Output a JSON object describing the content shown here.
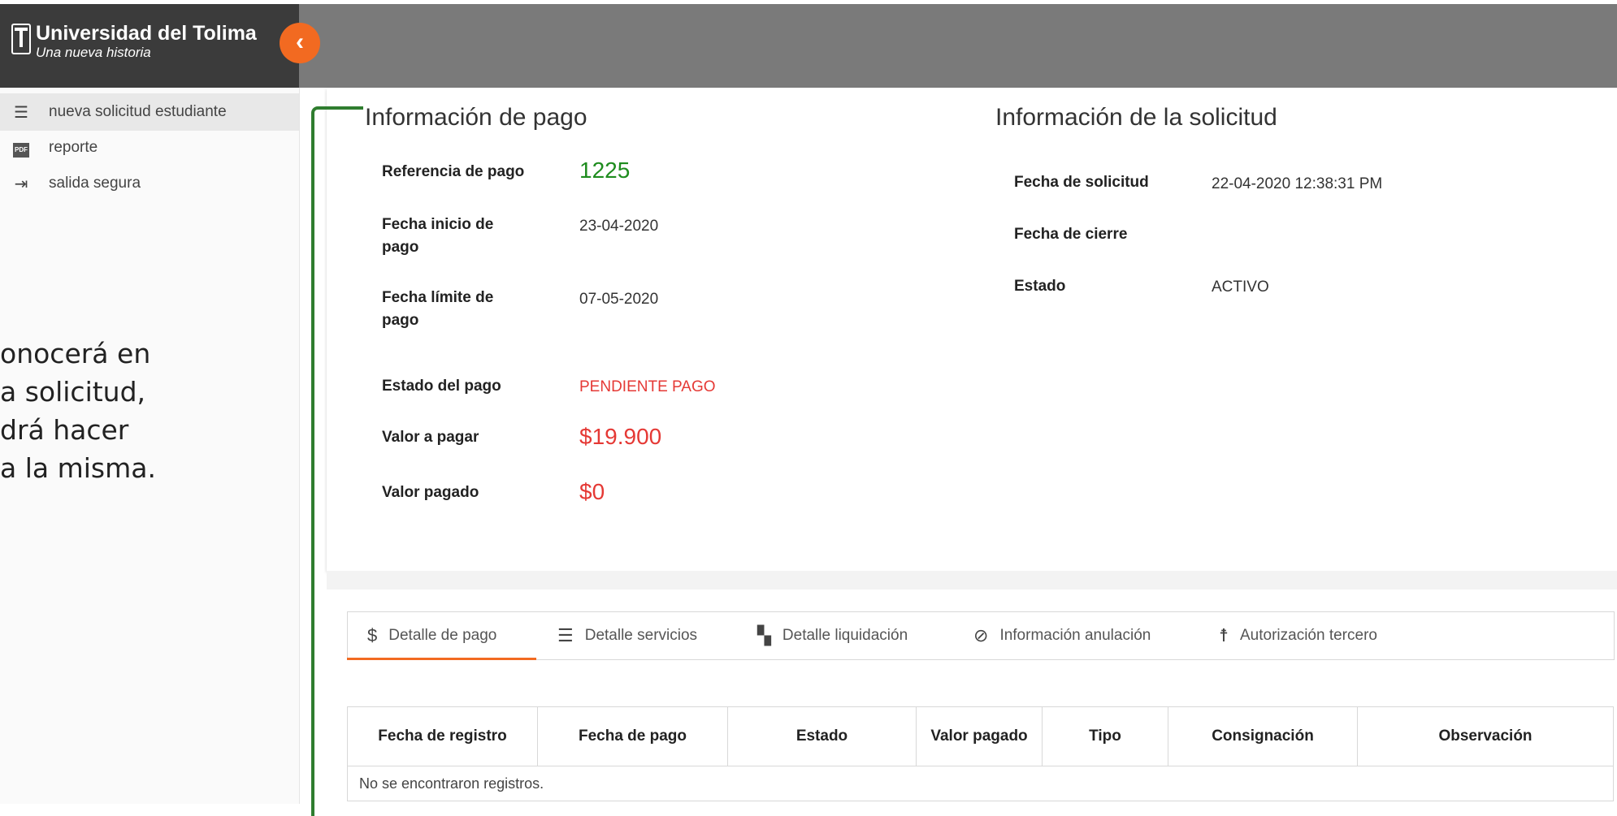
{
  "brand": {
    "name": "Universidad del Tolima",
    "slogan": "Una nueva historia"
  },
  "sidebar": {
    "items": [
      {
        "label": "nueva solicitud estudiante",
        "icon": "list-icon",
        "active": true
      },
      {
        "label": "reporte",
        "icon": "pdf-icon"
      },
      {
        "label": "salida segura",
        "icon": "logout-icon"
      }
    ],
    "pdf_badge": "PDF"
  },
  "overlay_text": [
    "onocerá en",
    "a solicitud,",
    "drá hacer",
    "a la misma."
  ],
  "payment": {
    "title": "Información de pago",
    "reference_label": "Referencia de pago",
    "reference_value": "1225",
    "start_label": "Fecha inicio de pago",
    "start_value": "23-04-2020",
    "limit_label": "Fecha límite de pago",
    "limit_value": "07-05-2020",
    "status_label": "Estado del pago",
    "status_value": "PENDIENTE PAGO",
    "amount_label": "Valor a pagar",
    "amount_value": "$19.900",
    "paid_label": "Valor pagado",
    "paid_value": "$0"
  },
  "request": {
    "title": "Información de la solicitud",
    "date_label": "Fecha de solicitud",
    "date_value": "22-04-2020 12:38:31 PM",
    "close_label": "Fecha de cierre",
    "close_value": "",
    "state_label": "Estado",
    "state_value": "ACTIVO"
  },
  "tabs": [
    {
      "label": "Detalle de pago",
      "icon": "dollar-icon",
      "glyph": "$",
      "active": true
    },
    {
      "label": "Detalle servicios",
      "icon": "services-icon",
      "glyph": "☰"
    },
    {
      "label": "Detalle liquidación",
      "icon": "liquidation-icon",
      "glyph": "▚"
    },
    {
      "label": "Información anulación",
      "icon": "cancel-icon",
      "glyph": "⊘"
    },
    {
      "label": "Autorización tercero",
      "icon": "accessibility-icon",
      "glyph": "☨"
    }
  ],
  "table": {
    "headers": [
      "Fecha de registro",
      "Fecha de pago",
      "Estado",
      "Valor pagado",
      "Tipo",
      "Consignación",
      "Observación"
    ],
    "empty_message": "No se encontraron registros."
  },
  "colors": {
    "accent": "#f26a21",
    "green": "#1e8c1e",
    "red": "#e53935",
    "header": "#7a7a7a",
    "brand_bg": "#3b3b3b"
  }
}
